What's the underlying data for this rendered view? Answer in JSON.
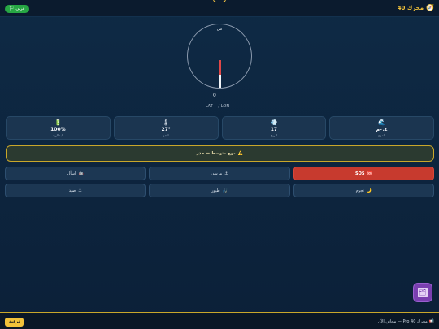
{
  "header": {
    "brand_icon": "🧭",
    "brand_title": "محرك 40",
    "language_icon": "🏳",
    "language_label": "عربي"
  },
  "compass": {
    "north_label": "ش",
    "heading_value": "0",
    "coords_text": "LAT -- / LON --"
  },
  "stats": [
    {
      "icon": "🌊",
      "value": "٠.٤م",
      "label": "الموج"
    },
    {
      "icon": "💨",
      "value": "17",
      "label": "الريح"
    },
    {
      "icon": "🌡",
      "value": "27°",
      "label": "الجو"
    },
    {
      "icon": "🔋",
      "value": "100%",
      "label": "البطارية"
    }
  ],
  "warning": {
    "icon": "⚠️",
    "text": "موج متوسط — حذر"
  },
  "actions": [
    {
      "icon": "🆘",
      "label": "SOS"
    },
    {
      "icon": "⚓",
      "label": "مرسى"
    },
    {
      "icon": "🤖",
      "label": "اسأل"
    },
    {
      "icon": "🌙",
      "label": "نجوم"
    },
    {
      "icon": "🎣",
      "label": "طيور"
    },
    {
      "icon": "⚓",
      "label": "صيد"
    }
  ],
  "footer": {
    "cta_label": "ترقية",
    "promo_icon": "📢",
    "promo_text": "محرك 40 Pro — مجاني الآن"
  },
  "fab": {
    "icon": "🗂"
  },
  "colors": {
    "accent": "#f2c23a",
    "sos": "#c73a2e",
    "background": "#0e2a45",
    "card": "#1b3550"
  }
}
